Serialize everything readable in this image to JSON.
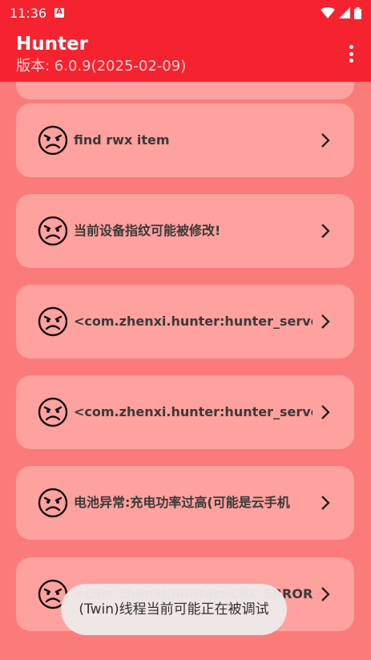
{
  "status_bar": {
    "time": "11:36"
  },
  "app_bar": {
    "title": "Hunter",
    "subtitle": "版本: 6.0.9(2025-02-09)"
  },
  "items": [
    {
      "label": "find rwx item"
    },
    {
      "label": "当前设备指纹可能被修改!"
    },
    {
      "label": "<com.zhenxi.hunter:hunter_server_re"
    },
    {
      "label": "<com.zhenxi.hunter:hunter_server_re"
    },
    {
      "label": "电池异常:充电功率过高(可能是云手机"
    },
    {
      "label": "<com.zhenxi.hunter>CRC ERROR"
    }
  ],
  "toast": {
    "text": "(Twin)线程当前可能正在被调试"
  },
  "colors": {
    "primary": "#f5232f",
    "background": "#fb7b7b",
    "card": "#ffa19e"
  }
}
